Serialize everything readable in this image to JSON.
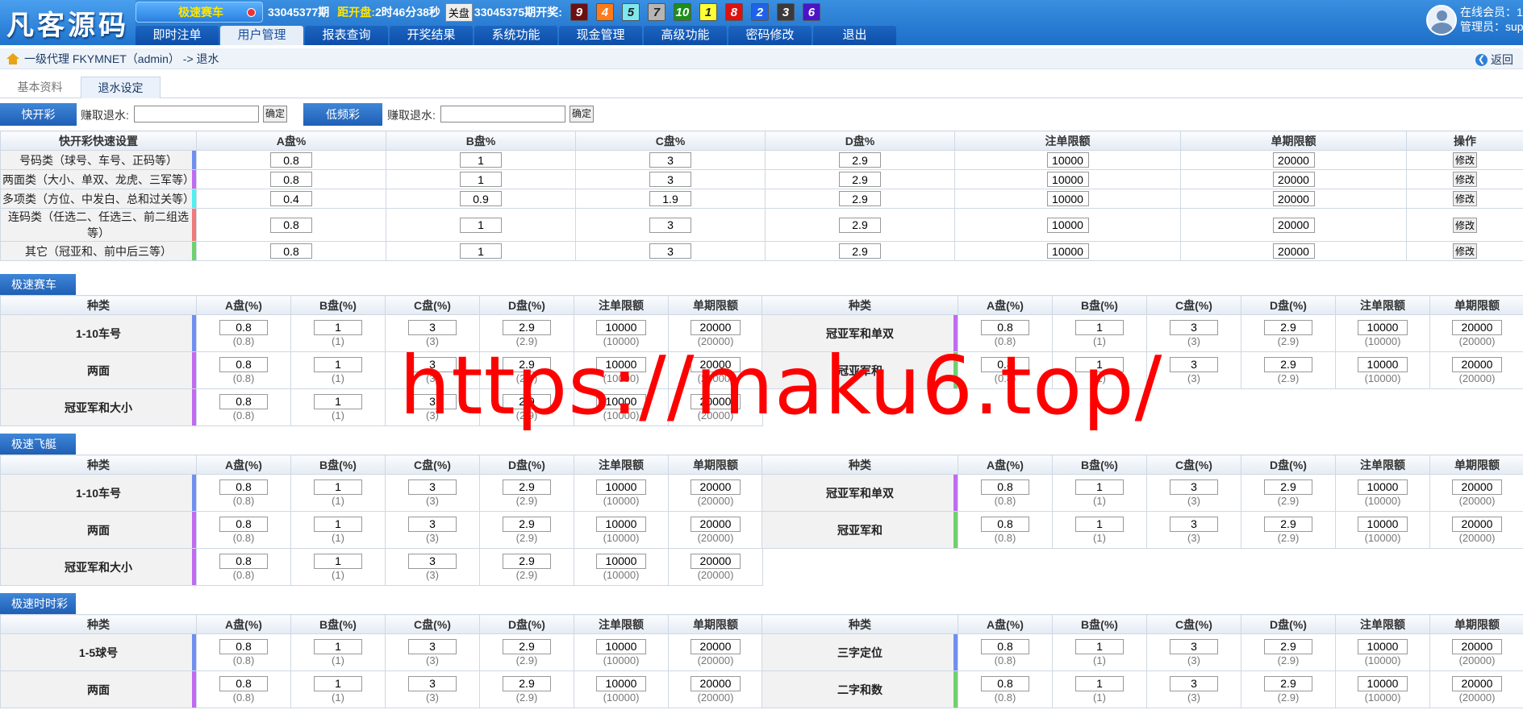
{
  "logo": "凡客源码",
  "header": {
    "game": "极速赛车",
    "current_period": "33045377期",
    "countdown_label": "距开盘:",
    "countdown": "2时46分38秒",
    "close_label": "关盘",
    "last_period": "33045375期开奖:",
    "balls": [
      {
        "n": "9",
        "bg": "#6b0f12",
        "fg": "#fff"
      },
      {
        "n": "4",
        "bg": "#ff7a1a",
        "fg": "#fff"
      },
      {
        "n": "5",
        "bg": "#7ee8f0",
        "fg": "#222"
      },
      {
        "n": "7",
        "bg": "#b5b5b5",
        "fg": "#222"
      },
      {
        "n": "10",
        "bg": "#1a8f1a",
        "fg": "#fff"
      },
      {
        "n": "1",
        "bg": "#ffff33",
        "fg": "#222"
      },
      {
        "n": "8",
        "bg": "#e01010",
        "fg": "#fff"
      },
      {
        "n": "2",
        "bg": "#1e62e8",
        "fg": "#fff"
      },
      {
        "n": "3",
        "bg": "#3a3a3a",
        "fg": "#fff"
      },
      {
        "n": "6",
        "bg": "#4a14c8",
        "fg": "#fff"
      }
    ]
  },
  "nav": [
    "即时注单",
    "用户管理",
    "报表查询",
    "开奖结果",
    "系统功能",
    "现金管理",
    "高级功能",
    "密码修改",
    "退出"
  ],
  "nav_active": 1,
  "user": {
    "line1": "在线会员：1",
    "line2": "管理员：super"
  },
  "breadcrumb": "一级代理 FKYMNET（admin） -> 退水",
  "back_label": "返回",
  "subtabs": [
    "基本资料",
    "退水设定"
  ],
  "quick": {
    "fast_label": "快开彩",
    "earn_label": "赚取退水:",
    "ok": "确定",
    "slow_label": "低频彩",
    "earn_label2": "赚取退水:",
    "ok2": "确定"
  },
  "quick_table": {
    "headers": [
      "快开彩快速设置",
      "A盘%",
      "B盘%",
      "C盘%",
      "D盘%",
      "注单限额",
      "单期限额",
      "操作"
    ],
    "edit_label": "修改",
    "rows": [
      {
        "name": "号码类（球号、车号、正码等）",
        "color": "#6f8ff0",
        "a": "0.8",
        "b": "1",
        "c": "3",
        "d": "2.9",
        "order": "10000",
        "period": "20000"
      },
      {
        "name": "两面类（大小、单双、龙虎、三军等）",
        "color": "#c06bf0",
        "a": "0.8",
        "b": "1",
        "c": "3",
        "d": "2.9",
        "order": "10000",
        "period": "20000"
      },
      {
        "name": "多项类（方位、中发白、总和过关等）",
        "color": "#4ff0ef",
        "a": "0.4",
        "b": "0.9",
        "c": "1.9",
        "d": "2.9",
        "order": "10000",
        "period": "20000"
      },
      {
        "name": "连码类（任选二、任选三、前二组选等）",
        "color": "#f07a7a",
        "a": "0.8",
        "b": "1",
        "c": "3",
        "d": "2.9",
        "order": "10000",
        "period": "20000"
      },
      {
        "name": "其它（冠亚和、前中后三等）",
        "color": "#6fd06f",
        "a": "0.8",
        "b": "1",
        "c": "3",
        "d": "2.9",
        "order": "10000",
        "period": "20000"
      }
    ]
  },
  "col_headers": [
    "种类",
    "A盘(%)",
    "B盘(%)",
    "C盘(%)",
    "D盘(%)",
    "注单限额",
    "单期限额"
  ],
  "sections": [
    {
      "title": "极速赛车",
      "left": [
        {
          "name": "1-10车号",
          "color": "#6f8ff0",
          "v": [
            "0.8",
            "1",
            "3",
            "2.9",
            "10000",
            "20000"
          ],
          "s": [
            "(0.8)",
            "(1)",
            "(3)",
            "(2.9)",
            "(10000)",
            "(20000)"
          ]
        },
        {
          "name": "两面",
          "color": "#c06bf0",
          "v": [
            "0.8",
            "1",
            "3",
            "2.9",
            "10000",
            "20000"
          ],
          "s": [
            "(0.8)",
            "(1)",
            "(3)",
            "(2.9)",
            "(10000)",
            "(20000)"
          ]
        },
        {
          "name": "冠亚军和大小",
          "color": "#c06bf0",
          "v": [
            "0.8",
            "1",
            "3",
            "2.9",
            "10000",
            "20000"
          ],
          "s": [
            "(0.8)",
            "(1)",
            "(3)",
            "(2.9)",
            "(10000)",
            "(20000)"
          ]
        }
      ],
      "right": [
        {
          "name": "冠亚军和单双",
          "color": "#c06bf0",
          "v": [
            "0.8",
            "1",
            "3",
            "2.9",
            "10000",
            "20000"
          ],
          "s": [
            "(0.8)",
            "(1)",
            "(3)",
            "(2.9)",
            "(10000)",
            "(20000)"
          ]
        },
        {
          "name": "冠亚军和",
          "color": "#6fd06f",
          "v": [
            "0.8",
            "1",
            "3",
            "2.9",
            "10000",
            "20000"
          ],
          "s": [
            "(0.8)",
            "(1)",
            "(3)",
            "(2.9)",
            "(10000)",
            "(20000)"
          ]
        }
      ]
    },
    {
      "title": "极速飞艇",
      "left": [
        {
          "name": "1-10车号",
          "color": "#6f8ff0",
          "v": [
            "0.8",
            "1",
            "3",
            "2.9",
            "10000",
            "20000"
          ],
          "s": [
            "(0.8)",
            "(1)",
            "(3)",
            "(2.9)",
            "(10000)",
            "(20000)"
          ]
        },
        {
          "name": "两面",
          "color": "#c06bf0",
          "v": [
            "0.8",
            "1",
            "3",
            "2.9",
            "10000",
            "20000"
          ],
          "s": [
            "(0.8)",
            "(1)",
            "(3)",
            "(2.9)",
            "(10000)",
            "(20000)"
          ]
        },
        {
          "name": "冠亚军和大小",
          "color": "#c06bf0",
          "v": [
            "0.8",
            "1",
            "3",
            "2.9",
            "10000",
            "20000"
          ],
          "s": [
            "(0.8)",
            "(1)",
            "(3)",
            "(2.9)",
            "(10000)",
            "(20000)"
          ]
        }
      ],
      "right": [
        {
          "name": "冠亚军和单双",
          "color": "#c06bf0",
          "v": [
            "0.8",
            "1",
            "3",
            "2.9",
            "10000",
            "20000"
          ],
          "s": [
            "(0.8)",
            "(1)",
            "(3)",
            "(2.9)",
            "(10000)",
            "(20000)"
          ]
        },
        {
          "name": "冠亚军和",
          "color": "#6fd06f",
          "v": [
            "0.8",
            "1",
            "3",
            "2.9",
            "10000",
            "20000"
          ],
          "s": [
            "(0.8)",
            "(1)",
            "(3)",
            "(2.9)",
            "(10000)",
            "(20000)"
          ]
        }
      ]
    },
    {
      "title": "极速时时彩",
      "left": [
        {
          "name": "1-5球号",
          "color": "#6f8ff0",
          "v": [
            "0.8",
            "1",
            "3",
            "2.9",
            "10000",
            "20000"
          ],
          "s": [
            "(0.8)",
            "(1)",
            "(3)",
            "(2.9)",
            "(10000)",
            "(20000)"
          ]
        },
        {
          "name": "两面",
          "color": "#c06bf0",
          "v": [
            "0.8",
            "1",
            "3",
            "2.9",
            "10000",
            "20000"
          ],
          "s": [
            "(0.8)",
            "(1)",
            "(3)",
            "(2.9)",
            "(10000)",
            "(20000)"
          ]
        }
      ],
      "right": [
        {
          "name": "三字定位",
          "color": "#6f8ff0",
          "v": [
            "0.8",
            "1",
            "3",
            "2.9",
            "10000",
            "20000"
          ],
          "s": [
            "(0.8)",
            "(1)",
            "(3)",
            "(2.9)",
            "(10000)",
            "(20000)"
          ]
        },
        {
          "name": "二字和数",
          "color": "#6fd06f",
          "v": [
            "0.8",
            "1",
            "3",
            "2.9",
            "10000",
            "20000"
          ],
          "s": [
            "(0.8)",
            "(1)",
            "(3)",
            "(2.9)",
            "(10000)",
            "(20000)"
          ]
        }
      ]
    }
  ],
  "watermark": "https://maku6.top/"
}
